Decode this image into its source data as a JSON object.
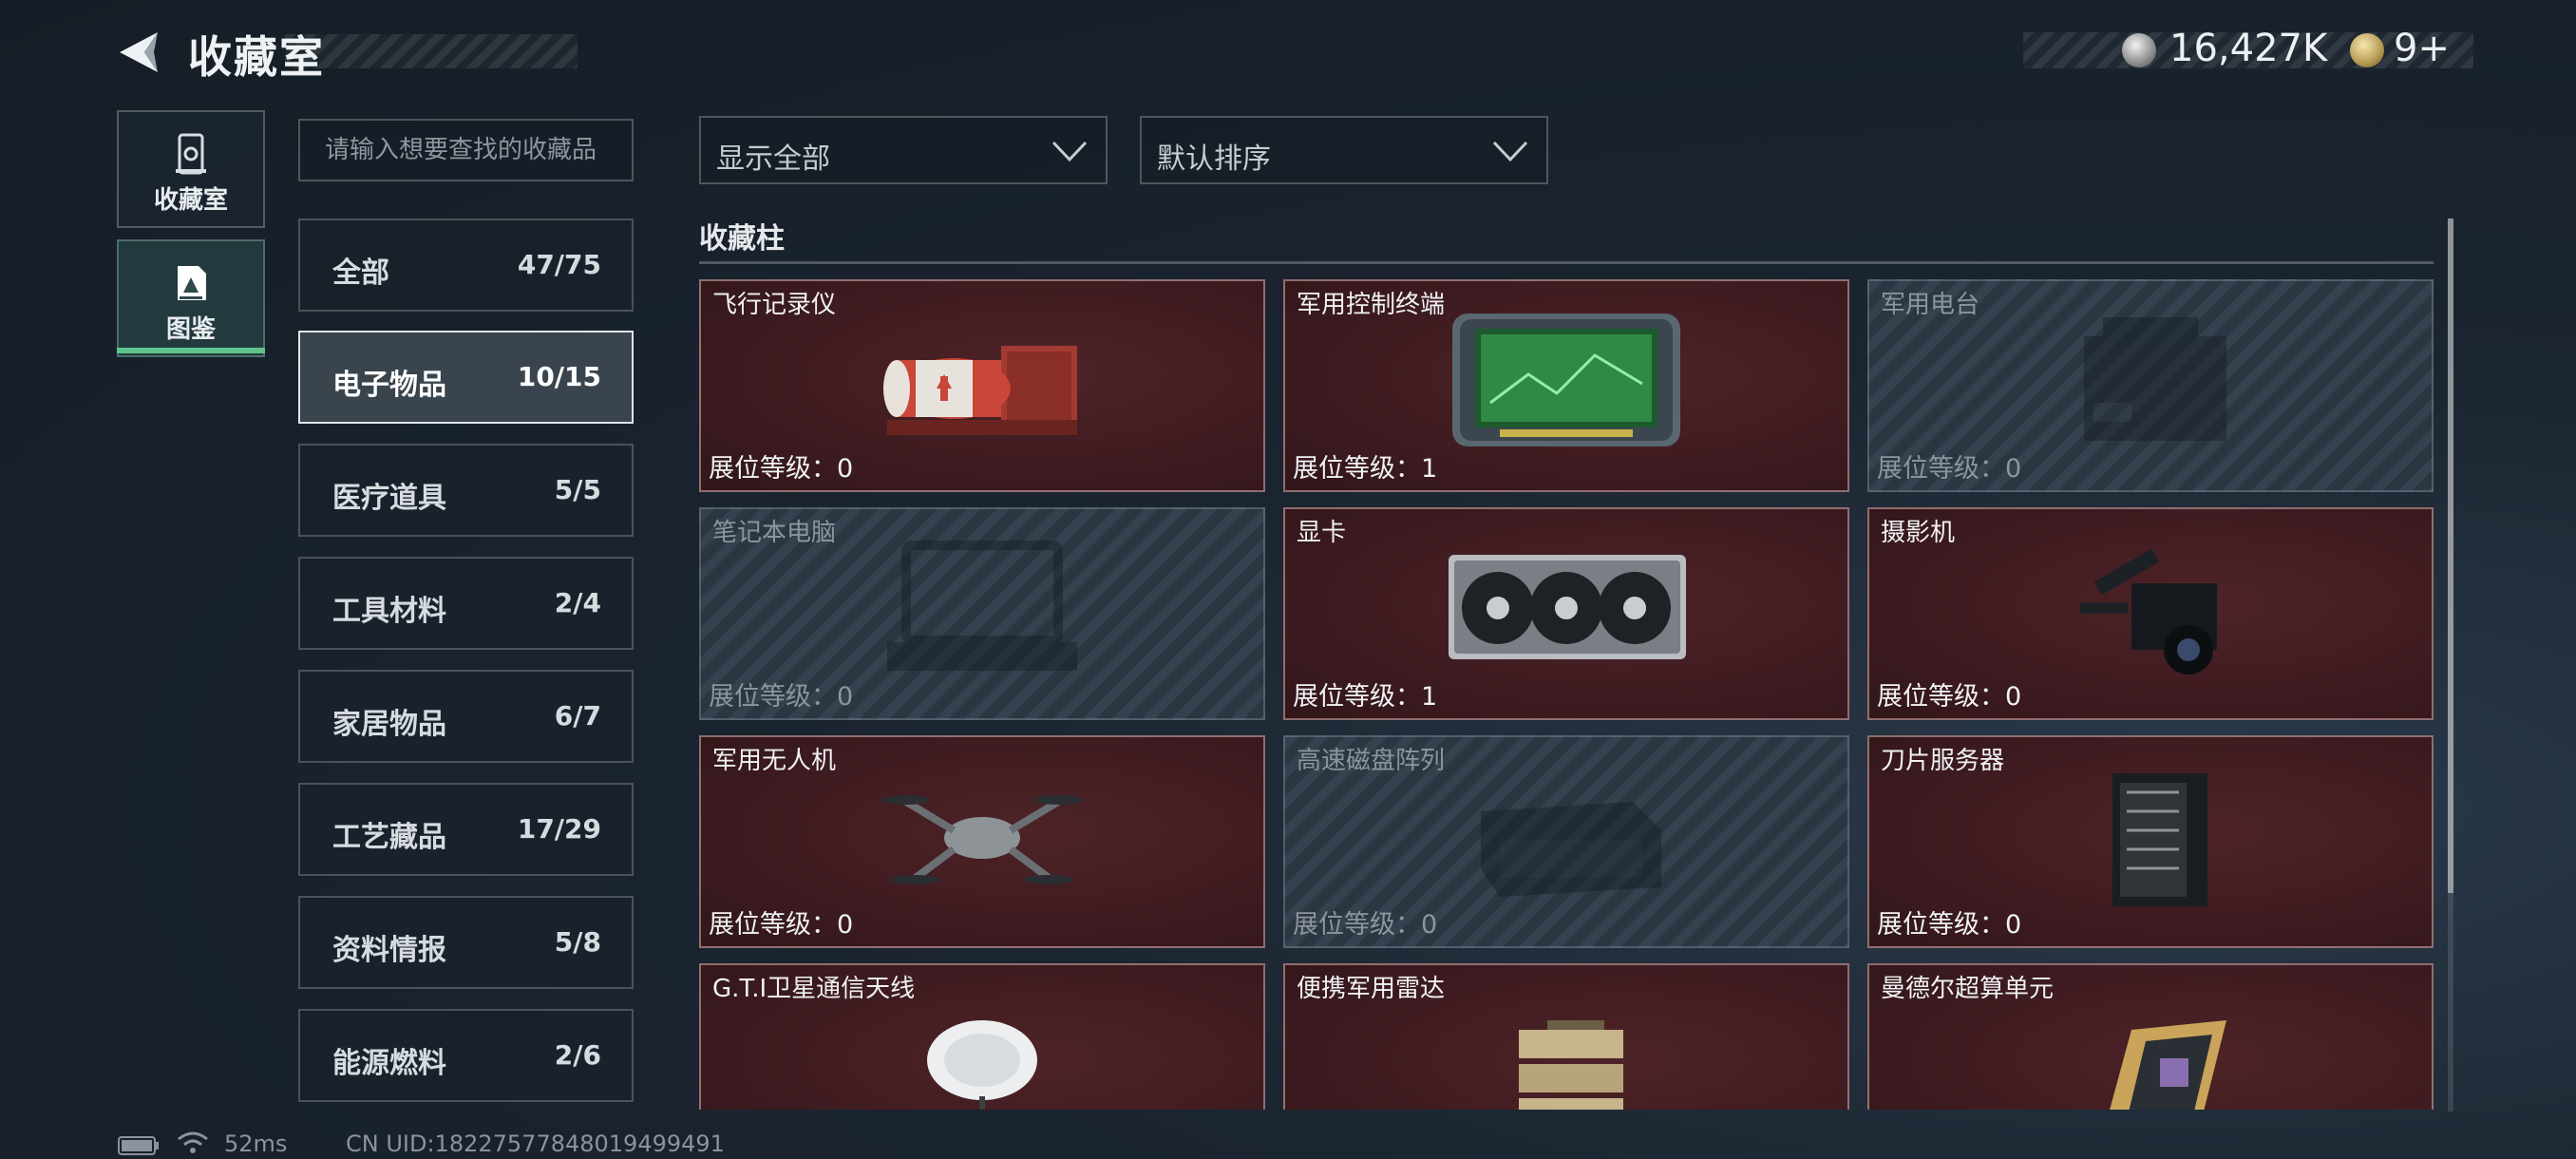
{
  "header": {
    "title": "收藏室",
    "money": "16,427K",
    "tickets": "9+"
  },
  "nav": {
    "collection_label": "收藏室",
    "codex_label": "图鉴"
  },
  "search": {
    "placeholder": "请输入想要查找的收藏品"
  },
  "categories": [
    {
      "name": "全部",
      "count": "47/75"
    },
    {
      "name": "电子物品",
      "count": "10/15"
    },
    {
      "name": "医疗道具",
      "count": "5/5"
    },
    {
      "name": "工具材料",
      "count": "2/4"
    },
    {
      "name": "家居物品",
      "count": "6/7"
    },
    {
      "name": "工艺藏品",
      "count": "17/29"
    },
    {
      "name": "资料情报",
      "count": "5/8"
    },
    {
      "name": "能源燃料",
      "count": "2/6"
    }
  ],
  "filters": {
    "show": "显示全部",
    "sort": "默认排序"
  },
  "section": {
    "title": "收藏柱"
  },
  "items": [
    {
      "name": "飞行记录仪",
      "level": "展位等级：0",
      "owned": true,
      "icon": "flight-recorder"
    },
    {
      "name": "军用控制终端",
      "level": "展位等级：1",
      "owned": true,
      "icon": "control-terminal"
    },
    {
      "name": "军用电台",
      "level": "展位等级：0",
      "owned": false,
      "icon": "military-radio"
    },
    {
      "name": "笔记本电脑",
      "level": "展位等级：0",
      "owned": false,
      "icon": "laptop"
    },
    {
      "name": "显卡",
      "level": "展位等级：1",
      "owned": true,
      "icon": "graphics-card"
    },
    {
      "name": "摄影机",
      "level": "展位等级：0",
      "owned": true,
      "icon": "video-camera"
    },
    {
      "name": "军用无人机",
      "level": "展位等级：0",
      "owned": true,
      "icon": "drone"
    },
    {
      "name": "高速磁盘阵列",
      "level": "展位等级：0",
      "owned": false,
      "icon": "disk-array"
    },
    {
      "name": "刀片服务器",
      "level": "展位等级：0",
      "owned": true,
      "icon": "blade-server"
    },
    {
      "name": "G.T.I卫星通信天线",
      "level": "",
      "owned": true,
      "icon": "satellite-dish"
    },
    {
      "name": "便携军用雷达",
      "level": "",
      "owned": true,
      "icon": "portable-radar"
    },
    {
      "name": "曼德尔超算单元",
      "level": "",
      "owned": true,
      "icon": "supercomputer-unit"
    }
  ],
  "footer": {
    "ping": "52ms",
    "uid": "CN UID:18227577848019499491"
  },
  "colors": {
    "owned_card": "#3d1b20",
    "locked_card": "#26313c",
    "accent_green": "#5ec48b"
  }
}
